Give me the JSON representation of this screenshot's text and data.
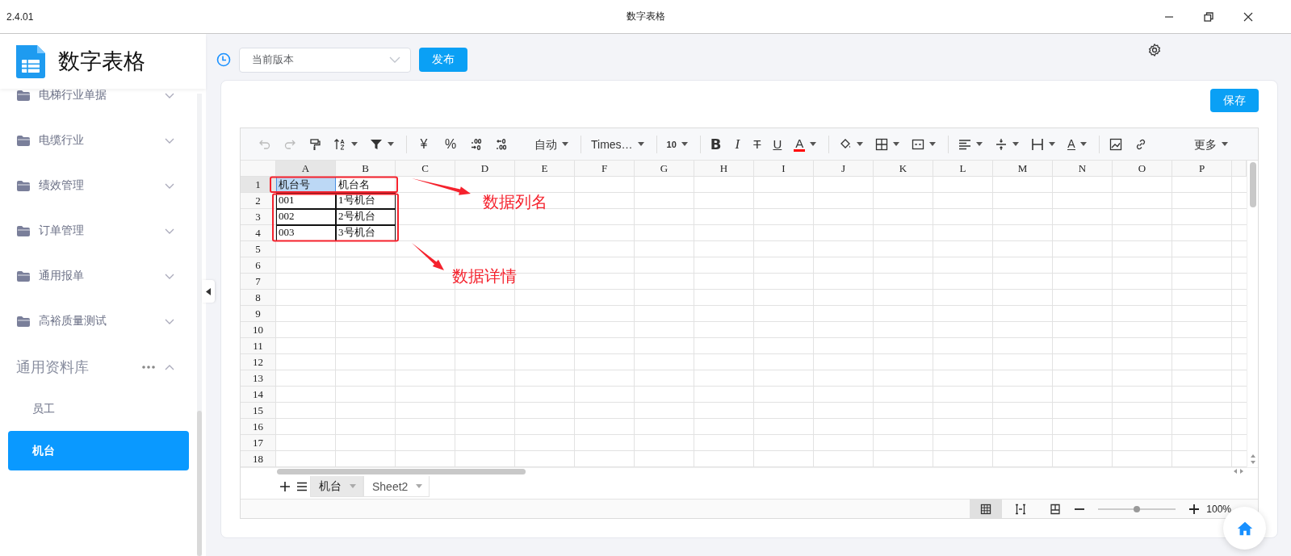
{
  "window": {
    "version": "2.4.01",
    "title": "数字表格"
  },
  "sidebar": {
    "app_name": "数字表格",
    "groups": [
      {
        "label": "电梯行业单据",
        "expanded": false
      },
      {
        "label": "电缆行业",
        "expanded": false
      },
      {
        "label": "绩效管理",
        "expanded": false
      },
      {
        "label": "订单管理",
        "expanded": false
      },
      {
        "label": "通用报单",
        "expanded": false
      },
      {
        "label": "高裕质量测试",
        "expanded": false
      }
    ],
    "library": {
      "label": "通用资料库",
      "expanded": true,
      "items": [
        {
          "label": "员工",
          "selected": false
        },
        {
          "label": "机台",
          "selected": true
        }
      ]
    }
  },
  "version_select": {
    "value": "当前版本"
  },
  "publish_button": "发布",
  "save_button": "保存",
  "toolbar": {
    "currency": "¥",
    "percent": "%",
    "number_format": "自动",
    "font": "Times…",
    "font_size": "10",
    "bold": "B",
    "italic": "I",
    "strikethrough": "T",
    "underline": "U",
    "font_color": "A",
    "text_rotate": "A",
    "more": "更多"
  },
  "sheet": {
    "columns": [
      "A",
      "B",
      "C",
      "D",
      "E",
      "F",
      "G",
      "H",
      "I",
      "J",
      "K",
      "L",
      "M",
      "N",
      "O",
      "P"
    ],
    "rows": [
      {
        "number": "1",
        "cells": [
          {
            "text": "机台号",
            "selected": true,
            "bordered": false
          },
          {
            "text": "机台名",
            "selected": false,
            "bordered": false
          }
        ]
      },
      {
        "number": "2",
        "cells": [
          {
            "text": "001",
            "selected": false,
            "bordered": true
          },
          {
            "text": "1号机台",
            "selected": false,
            "bordered": true
          }
        ]
      },
      {
        "number": "3",
        "cells": [
          {
            "text": "002",
            "selected": false,
            "bordered": true
          },
          {
            "text": "2号机台",
            "selected": false,
            "bordered": true
          }
        ]
      },
      {
        "number": "4",
        "cells": [
          {
            "text": "003",
            "selected": false,
            "bordered": true
          },
          {
            "text": "3号机台",
            "selected": false,
            "bordered": true
          }
        ]
      },
      {
        "number": "5"
      },
      {
        "number": "6"
      },
      {
        "number": "7"
      },
      {
        "number": "8"
      },
      {
        "number": "9"
      },
      {
        "number": "10"
      },
      {
        "number": "11"
      },
      {
        "number": "12"
      },
      {
        "number": "13"
      },
      {
        "number": "14"
      },
      {
        "number": "15"
      },
      {
        "number": "16"
      },
      {
        "number": "17"
      },
      {
        "number": "18"
      }
    ]
  },
  "sheet_tabs": [
    {
      "label": "机台",
      "selected": true
    },
    {
      "label": "Sheet2",
      "selected": false
    }
  ],
  "view_modes": [
    {
      "kind": "grid",
      "selected": true
    },
    {
      "kind": "page_break",
      "selected": false
    },
    {
      "kind": "page_layout",
      "selected": false
    }
  ],
  "zoom": {
    "level": 0.5,
    "reading": "100%"
  },
  "annotations": [
    {
      "text": "数据列名"
    },
    {
      "text": "数据详情"
    }
  ]
}
